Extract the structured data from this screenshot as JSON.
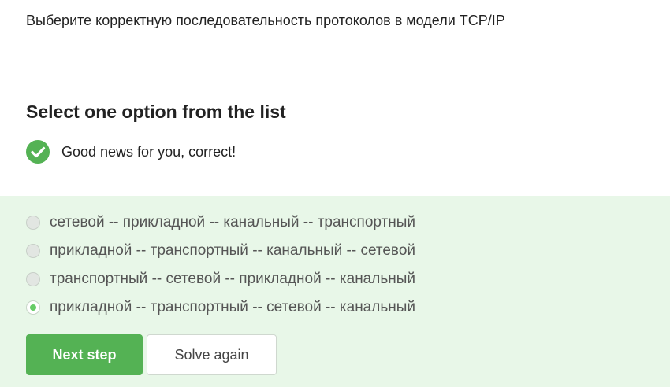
{
  "question": {
    "text": "Выберите корректную последовательность протоколов в модели TCP/IP"
  },
  "section": {
    "title": "Select one option from the list"
  },
  "feedback": {
    "icon": "check-circle-icon",
    "text": "Good news for you, correct!",
    "color": "#54b254"
  },
  "options": [
    {
      "label": "сетевой -- прикладной -- канальный -- транспортный",
      "selected": false
    },
    {
      "label": "прикладной -- транспортный -- канальный -- сетевой",
      "selected": false
    },
    {
      "label": "транспортный -- сетевой -- прикладной -- канальный",
      "selected": false
    },
    {
      "label": "прикладной -- транспортный -- сетевой -- канальный",
      "selected": true
    }
  ],
  "buttons": {
    "next_label": "Next step",
    "solve_again_label": "Solve again"
  },
  "colors": {
    "accent": "#54b254",
    "panel_background": "#e8f7e8"
  }
}
